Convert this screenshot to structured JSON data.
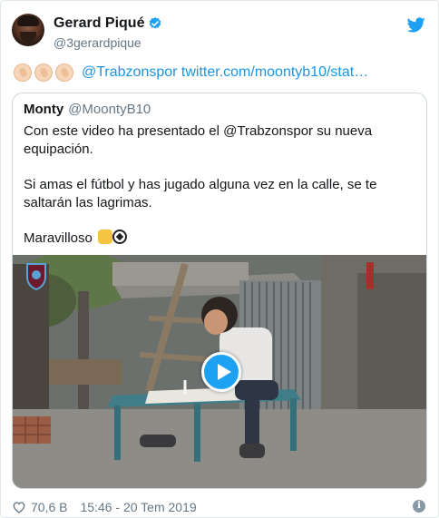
{
  "author": {
    "name": "Gerard Piqué",
    "handle": "@3gerardpique"
  },
  "tweet": {
    "link_text": "@Trabzonspor twitter.com/moontyb10/stat…"
  },
  "quoted": {
    "name": "Monty",
    "handle": "@MoontyB10",
    "paragraphs": [
      "Con este video ha presentado el @Trabzonspor su nueva equipación.",
      "Si amas el fútbol y has jugado alguna vez en la calle, se te saltarán las lagrimas.",
      "Maravilloso"
    ]
  },
  "footer": {
    "likes": "70,6 B",
    "timestamp": "15:46 - 20 Tem 2019"
  },
  "colors": {
    "link": "#1b95e0",
    "verified": "#1da1f2",
    "bird": "#1da1f2",
    "play": "#1da1f2"
  },
  "icons": [
    "verified-icon",
    "twitter-bird-icon",
    "play-icon",
    "heart-icon",
    "info-icon",
    "clapping-hands-emoji",
    "waving-hand-emoji",
    "soccer-ball-emoji",
    "trabzonspor-crest"
  ]
}
